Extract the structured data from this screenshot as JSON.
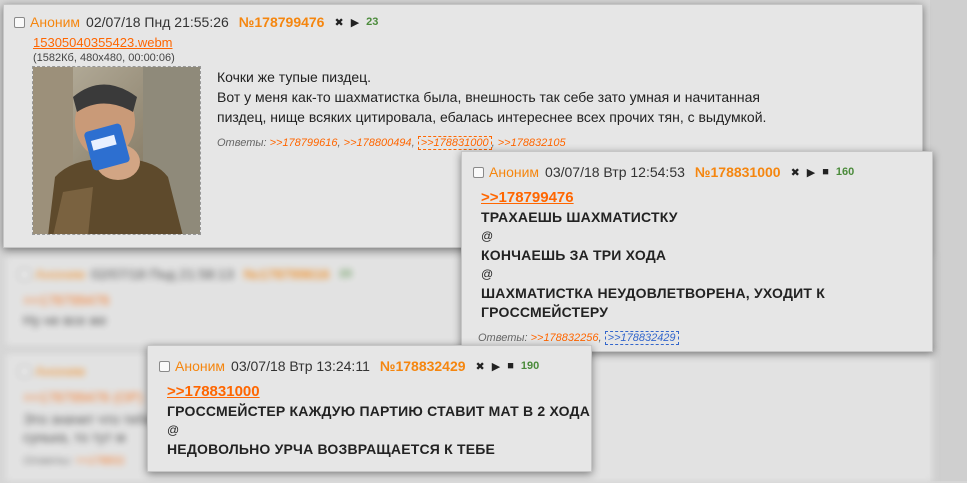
{
  "post1": {
    "name": "Аноним",
    "date": "02/07/18 Пнд 21:55:26",
    "num": "№178799476",
    "close_glyph": "✖",
    "play_glyph": "▶",
    "count": "23",
    "file_name": "15305040355423.webm",
    "file_meta": "(1582Кб, 480x480, 00:00:06)",
    "text_lines": [
      "Кочки же тупые пиздец.",
      "Вот у меня как-то шахматистка была, внешность так себе зато умная и начитанная",
      "пиздец, нище всяких цитировала, ебалась интереснее всех прочих тян, с выдумкой."
    ],
    "replies_label": "Ответы:",
    "replies": [
      ">>178799616",
      ">>178800494",
      ">>178831000",
      ">>178832105"
    ]
  },
  "bg_post": {
    "name": "Аноним",
    "date": "02/07/18 Пнд 21:58:13",
    "num": "№178799616",
    "count": "23",
    "ref": ">>178799476",
    "text": "Ну не все же"
  },
  "bg_post2": {
    "name": "Аноним",
    "ref": ">>178799476 (OP)",
    "text": "Это значит что тебе надо было ещё и денег дать, а если бабе больше помочь на",
    "text2": "сунька, то тут м",
    "replies_label": "Ответы:",
    "reply": ">>178831"
  },
  "post2": {
    "name": "Аноним",
    "date": "03/07/18 Втр 12:54:53",
    "num": "№178831000",
    "close_glyph": "✖",
    "play_glyph": "▶",
    "stop_glyph": "■",
    "count": "160",
    "ref": ">>178799476",
    "lines": [
      "ТРАХАЕШЬ ШАХМАТИСТКУ",
      "@",
      "КОНЧАЕШЬ ЗА ТРИ ХОДА",
      "@",
      "ШАХМАТИСТКА НЕУДОВЛЕТВОРЕНА, УХОДИТ К",
      "ГРОССМЕЙСТЕРУ"
    ],
    "replies_label": "Ответы:",
    "replies": [
      ">>178832256",
      ">>178832429"
    ]
  },
  "post3": {
    "name": "Аноним",
    "date": "03/07/18 Втр 13:24:11",
    "num": "№178832429",
    "close_glyph": "✖",
    "play_glyph": "▶",
    "stop_glyph": "■",
    "count": "190",
    "ref": ">>178831000",
    "lines": [
      "ГРОССМЕЙСТЕР КАЖДУЮ ПАРТИЮ СТАВИТ МАТ В 2 ХОДА",
      "@",
      "НЕДОВОЛЬНО УРЧА ВОЗВРАЩАЕТСЯ К ТЕБЕ"
    ]
  }
}
